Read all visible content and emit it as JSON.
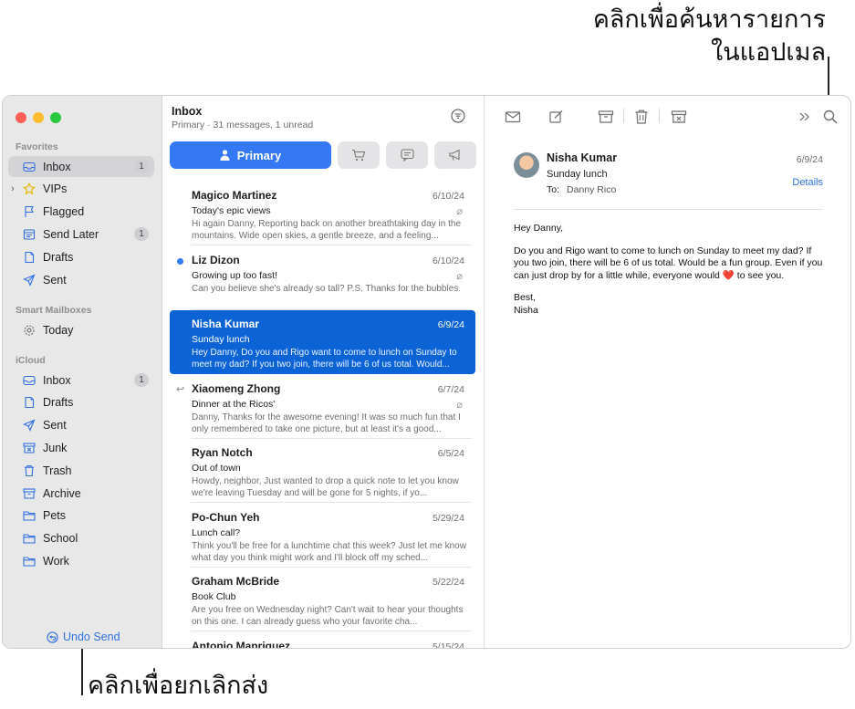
{
  "callouts": {
    "search_line1": "คลิกเพื่อค้นหารายการ",
    "search_line2": "ในแอปเมล",
    "undo": "คลิกเพื่อยกเลิกส่ง"
  },
  "sidebar": {
    "favorites_heading": "Favorites",
    "smart_heading": "Smart Mailboxes",
    "icloud_heading": "iCloud",
    "favorites": [
      {
        "label": "Inbox",
        "icon": "inbox-icon",
        "count": "1",
        "selected": true
      },
      {
        "label": "VIPs",
        "icon": "star-icon"
      },
      {
        "label": "Flagged",
        "icon": "flag-icon"
      },
      {
        "label": "Send Later",
        "icon": "send-later-icon",
        "count": "1"
      },
      {
        "label": "Drafts",
        "icon": "draft-icon"
      },
      {
        "label": "Sent",
        "icon": "paperplane-icon"
      }
    ],
    "smart": [
      {
        "label": "Today",
        "icon": "gear-icon"
      }
    ],
    "icloud": [
      {
        "label": "Inbox",
        "icon": "inbox-icon",
        "count": "1"
      },
      {
        "label": "Drafts",
        "icon": "draft-icon"
      },
      {
        "label": "Sent",
        "icon": "paperplane-icon"
      },
      {
        "label": "Junk",
        "icon": "junk-icon"
      },
      {
        "label": "Trash",
        "icon": "trash-icon"
      },
      {
        "label": "Archive",
        "icon": "archive-icon"
      },
      {
        "label": "Pets",
        "icon": "folder-icon"
      },
      {
        "label": "School",
        "icon": "folder-icon"
      },
      {
        "label": "Work",
        "icon": "folder-icon"
      }
    ],
    "undo_send": "Undo Send"
  },
  "list": {
    "title": "Inbox",
    "subtitle": "Primary · 31 messages, 1 unread",
    "primary_tab": "Primary",
    "messages": [
      {
        "from": "Magico Martinez",
        "date": "6/10/24",
        "subject": "Today's epic views",
        "preview": "Hi again Danny, Reporting back on another breathtaking day in the mountains. Wide open skies, a gentle breeze, and a feeling...",
        "attachment": true
      },
      {
        "from": "Liz Dizon",
        "date": "6/10/24",
        "subject": "Growing up too fast!",
        "preview": "Can you believe she's already so tall? P.S. Thanks for the bubbles.",
        "attachment": true,
        "unread": true
      },
      {
        "from": "Nisha Kumar",
        "date": "6/9/24",
        "subject": "Sunday lunch",
        "preview": "Hey Danny, Do you and Rigo want to come to lunch on Sunday to meet my dad? If you two join, there will be 6 of us total. Would...",
        "selected": true
      },
      {
        "from": "Xiaomeng Zhong",
        "date": "6/7/24",
        "subject": "Dinner at the Ricos'",
        "preview": "Danny, Thanks for the awesome evening! It was so much fun that I only remembered to take one picture, but at least it's a good...",
        "attachment": true,
        "replied": true
      },
      {
        "from": "Ryan Notch",
        "date": "6/5/24",
        "subject": "Out of town",
        "preview": "Howdy, neighbor, Just wanted to drop a quick note to let you know we're leaving Tuesday and will be gone for 5 nights, if yo..."
      },
      {
        "from": "Po-Chun Yeh",
        "date": "5/29/24",
        "subject": "Lunch call?",
        "preview": "Think you'll be free for a lunchtime chat this week? Just let me know what day you think might work and I'll block off my sched..."
      },
      {
        "from": "Graham McBride",
        "date": "5/22/24",
        "subject": "Book Club",
        "preview": "Are you free on Wednesday night? Can't wait to hear your thoughts on this one. I can already guess who your favorite cha..."
      },
      {
        "from": "Antonio Manriquez",
        "date": "5/15/24",
        "subject": "",
        "preview": ""
      }
    ]
  },
  "reader": {
    "sender": "Nisha Kumar",
    "subject": "Sunday lunch",
    "to_label": "To:",
    "to_name": "Danny Rico",
    "date": "6/9/24",
    "details": "Details",
    "greeting": "Hey Danny,",
    "body_part1": "Do you and Rigo want to come to lunch on Sunday to meet my dad? If you two join, there will be 6 of us total. Would be a fun group. Even if you can just drop by for a little while, everyone would",
    "heart": "❤️",
    "body_part2": "to see you.",
    "signoff": "Best,",
    "signature": "Nisha"
  }
}
